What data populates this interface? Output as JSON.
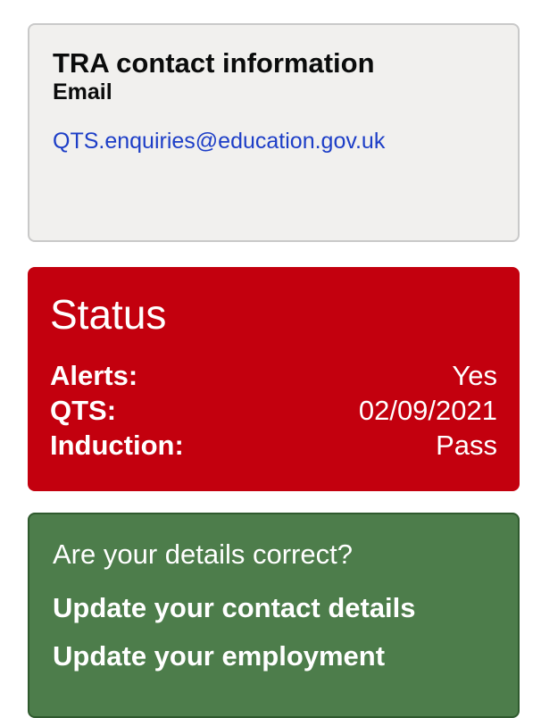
{
  "contact": {
    "title": "TRA contact information",
    "subtitle": "Email",
    "email": "QTS.enquiries@education.gov.uk"
  },
  "status": {
    "title": "Status",
    "rows": [
      {
        "label": "Alerts:",
        "value": "Yes"
      },
      {
        "label": "QTS:",
        "value": "02/09/2021"
      },
      {
        "label": "Induction:",
        "value": "Pass"
      }
    ]
  },
  "details": {
    "question": "Are your details correct?",
    "links": [
      "Update your contact details",
      "Update your employment"
    ]
  },
  "colors": {
    "status_bg": "#c3000e",
    "details_bg": "#4d7d4b",
    "link_blue": "#1d3ec7"
  }
}
